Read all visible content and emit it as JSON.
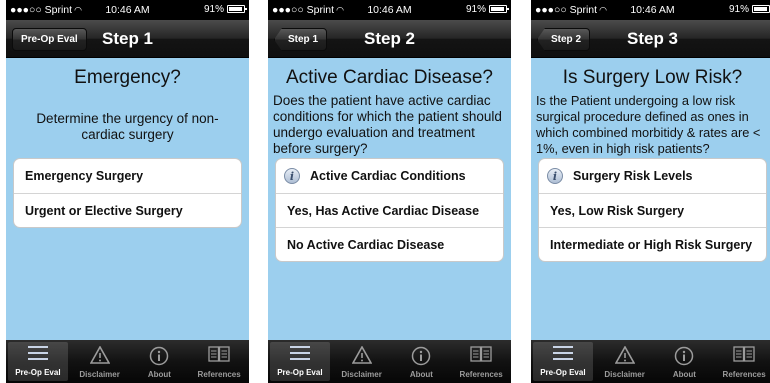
{
  "status": {
    "carrier": "●●●○○ Sprint",
    "time": "10:46 AM",
    "battery": "91%"
  },
  "tabs": [
    "Pre-Op Eval",
    "Disclaimer",
    "About",
    "References"
  ],
  "screens": [
    {
      "back": "Pre-Op Eval",
      "title": "Step 1",
      "heading": "Emergency?",
      "description": "Determine the urgency of non-cardiac surgery",
      "options": [
        "Emergency Surgery",
        "Urgent or Elective Surgery"
      ]
    },
    {
      "back": "Step 1",
      "title": "Step 2",
      "heading": "Active Cardiac Disease?",
      "description": "Does the patient have active cardiac conditions for which the patient should undergo evaluation and treatment before surgery?",
      "info": "Active Cardiac Conditions",
      "options": [
        "Yes, Has Active Cardiac Disease",
        "No Active Cardiac Disease"
      ]
    },
    {
      "back": "Step 2",
      "title": "Step 3",
      "heading": "Is Surgery Low Risk?",
      "description": "Is the Patient undergoing a low risk surgical procedure defined as ones in which combined morbitidy & rates are < 1%, even in high risk patients?",
      "info": "Surgery Risk Levels",
      "options": [
        "Yes, Low Risk Surgery",
        "Intermediate or High Risk Surgery"
      ]
    }
  ],
  "icons": {
    "wifi": "wifi-icon",
    "battery": "battery-icon",
    "back": "back-arrow-icon",
    "info": "info-icon",
    "tab_icons": [
      "list-icon",
      "warning-icon",
      "info-circle-icon",
      "book-icon"
    ]
  },
  "colors": {
    "background": "#9ccfee",
    "navbar": "#1a1a1a",
    "card": "#ffffff",
    "tabbar": "#0c0c0c"
  }
}
